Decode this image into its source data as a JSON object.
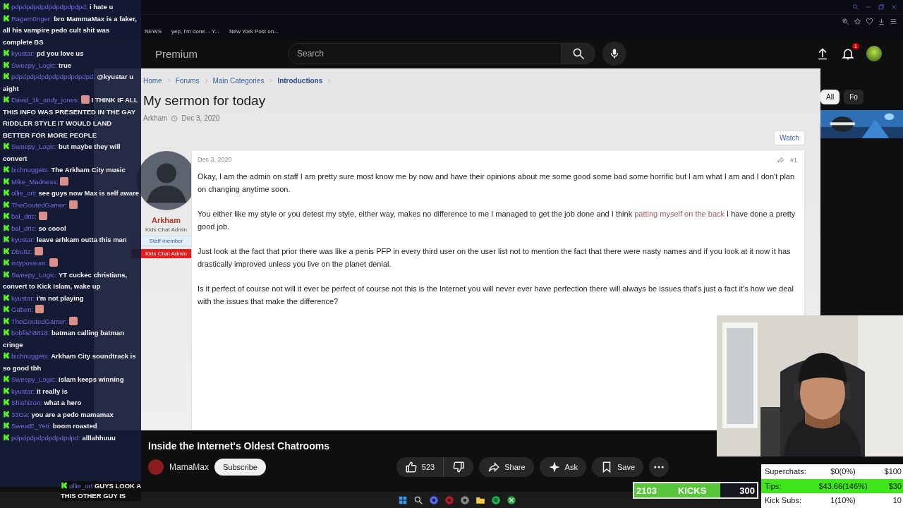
{
  "browser": {
    "bookmarks": [
      "NEWS",
      "yep, I'm done. - Y...",
      "New York Post on..."
    ]
  },
  "youtube": {
    "logo": "Premium",
    "search": {
      "placeholder": "Search"
    },
    "notifications": "1"
  },
  "forum": {
    "breadcrumb": [
      {
        "label": "Home",
        "current": false
      },
      {
        "label": "Forums",
        "current": false
      },
      {
        "label": "Main Categories",
        "current": false
      },
      {
        "label": "Introductions",
        "current": true
      }
    ],
    "title": "My sermon for today",
    "author": "Arkham",
    "date": "Dec 3, 2020",
    "watch": "Watch",
    "post": {
      "date": "Dec 3, 2020",
      "number": "#1",
      "author": "Arkham",
      "role": "Kids Chat Admin",
      "badges": [
        {
          "text": "Staff member",
          "kind": "staff"
        },
        {
          "text": "Kids Chat Admin",
          "kind": "admin"
        }
      ],
      "paragraphs": [
        {
          "text": "Okay, I am the admin on staff I am pretty sure most know me by now and have their opinions about me some good some bad some horrific but I am what I am and I don't plan on changing anytime soon."
        },
        {
          "text": "You either like my style or you detest my style, either way, makes no difference to me I managed to get the job done and I think ",
          "link": "patting myself on the back",
          "after": " I have done a pretty good job."
        },
        {
          "text": "Just look at the fact that prior there was like a penis PFP in every third user on the user list not to mention the fact that there were nasty names and if you look at it now it has drastically improved unless you live on the planet denial."
        },
        {
          "text": "Is it perfect of course not will it ever be perfect of course not this is the Internet you will never ever have perfection there will always be issues that's just a fact it's how we deal with the issues that make the difference?"
        }
      ]
    }
  },
  "video": {
    "title": "Inside the Internet's Oldest Chatrooms",
    "channel": "MamaMax",
    "subscribe": "Subscribe",
    "likes": "523",
    "actions": [
      {
        "label": "Share",
        "kind": "share"
      },
      {
        "label": "Ask",
        "kind": "ask"
      },
      {
        "label": "Save",
        "kind": "save"
      }
    ],
    "chips": [
      {
        "label": "All",
        "selected": true
      },
      {
        "label": "Fo",
        "selected": false
      }
    ]
  },
  "chat": {
    "messages": [
      {
        "user": "pdpdpdpdpdpdpdpdpdpd:",
        "text": "i hate u"
      },
      {
        "user": "Ragem0nger:",
        "text": "bro MammaMax is a faker, all his vampire pedo cult shit was complete BS"
      },
      {
        "user": "kyustar:",
        "text": "pd you love us"
      },
      {
        "user": "Sweepy_Logic:",
        "text": "true"
      },
      {
        "user": "pdpdpdpdpdpdpdpdpdpdpd:",
        "text": "@kyustar u aight"
      },
      {
        "user": "David_1k_andy_jones:",
        "emote": true,
        "text": "I THINK IF ALL THIS INFO WAS PRESENTED IN THE GAY RIDDLER STYLE IT WOULD LAND BETTER FOR MORE PEOPLE"
      },
      {
        "user": "Sweepy_Logic:",
        "text": "but maybe they will convert"
      },
      {
        "user": "bichnuggets:",
        "text": "The Arkham City music"
      },
      {
        "user": "Mike_Madness:",
        "emote": true
      },
      {
        "user": "ollie_ort:",
        "text": "see guys now Max is self aware"
      },
      {
        "user": "TheGoutedGamer:",
        "emote": true
      },
      {
        "user": "bal_dric:",
        "emote": true
      },
      {
        "user": "bal_dric:",
        "text": "so coool"
      },
      {
        "user": "kyustar:",
        "text": "leave arhkam outta this man"
      },
      {
        "user": "Dbuttz:",
        "emote": true
      },
      {
        "user": "mtypossum:",
        "emote": true
      },
      {
        "user": "Sweepy_Logic:",
        "text": "YT cuckec christians, convert to Kick Islam, wake up"
      },
      {
        "user": "kyustar:",
        "text": "i'm not playing"
      },
      {
        "user": "Gaben:",
        "emote": true
      },
      {
        "user": "TheGoutedGamer:",
        "emote": true
      },
      {
        "user": "bobfish8818:",
        "text": "batman calling batman cringe"
      },
      {
        "user": "bichnuggets:",
        "text": "Arkham City soundtrack is so good tbh"
      },
      {
        "user": "Sweepy_Logic:",
        "text": "Islam keeps winning"
      },
      {
        "user": "kyustar:",
        "text": "it really is"
      },
      {
        "user": "Shishizon:",
        "text": "what a hero"
      },
      {
        "user": "33Oa:",
        "text": "you are a pedo mamamax"
      },
      {
        "user": "SweatE_Yeti:",
        "text": "boom roasted"
      },
      {
        "user": "pdpdpdpdpdpdpdpdpd:",
        "text": "alllahhuuu"
      }
    ],
    "incoming": {
      "user": "ollie_ort",
      "text": "GUYS LOOK A THIS OTHER GUY IS"
    }
  },
  "goals": {
    "kicks": {
      "count": "2103",
      "label": "KICKS",
      "target": "300",
      "level": 0.7
    },
    "table": [
      {
        "label": "Superchats:",
        "value": "$0(0%)",
        "goal": "$100",
        "highlight": false
      },
      {
        "label": "Tips:",
        "value": "$43.66(146%)",
        "goal": "$30",
        "highlight": true
      },
      {
        "label": "Kick Subs:",
        "value": "1(10%)",
        "goal": "10",
        "highlight": false
      }
    ]
  }
}
